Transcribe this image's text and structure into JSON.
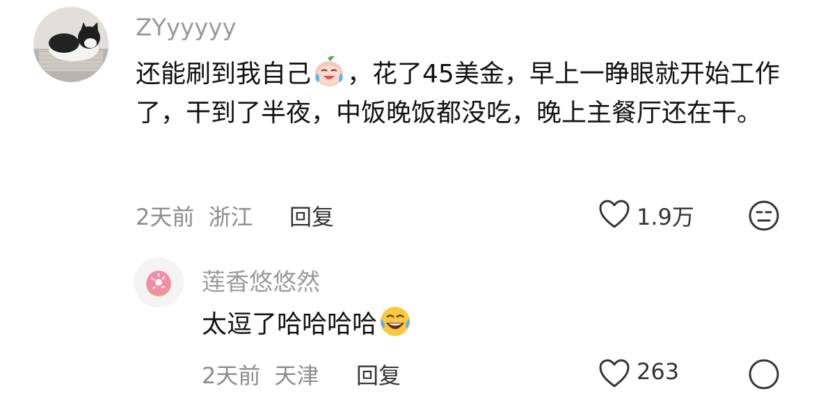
{
  "comment": {
    "username": "ZYyyyyy",
    "text_part1": "还能刷到我自己",
    "text_part2": "，花了45美金，早上一睁眼就开始工作了，干到了半夜，中饭晚饭都没吃，晚上主餐厅还在干。",
    "time": "2天前",
    "location": "浙江",
    "reply_label": "回复",
    "like_count": "1.9万",
    "avatar_icon": "cat-photo",
    "inline_emoji": "crying-laughing-peach-emoji"
  },
  "sub_reply": {
    "username": "莲香悠悠然",
    "text": "太逗了哈哈哈哈",
    "time": "2天前",
    "location": "天津",
    "reply_label": "回复",
    "like_count": "263",
    "avatar_icon": "donut-icon",
    "inline_emoji": "face-with-tears-of-joy-emoji"
  },
  "colors": {
    "username": "#9a9a9a",
    "meta": "#8c8c8c",
    "text": "#111111"
  }
}
